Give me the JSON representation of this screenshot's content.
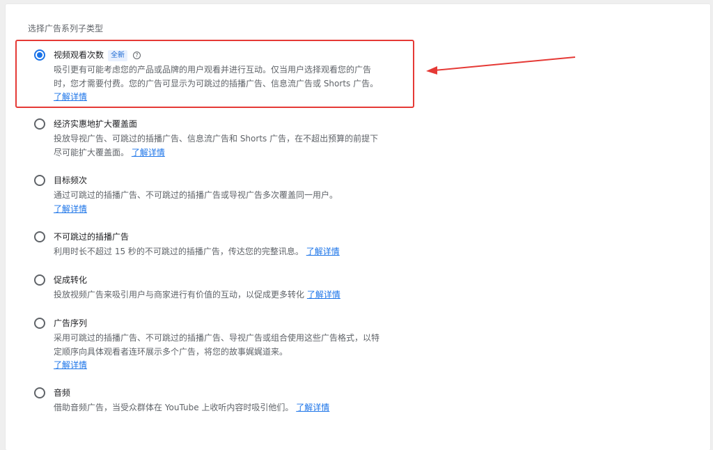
{
  "section": {
    "title": "选择广告系列子类型"
  },
  "options": [
    {
      "title": "视频观看次数",
      "badge": "全新",
      "help_icon": "help-circle-icon",
      "checked": true,
      "desc": "吸引更有可能考虑您的产品或品牌的用户观看并进行互动。仅当用户选择观看您的广告时，您才需要付费。您的广告可显示为可跳过的插播广告、信息流广告或 Shorts 广告。",
      "link": "了解详情"
    },
    {
      "title": "经济实惠地扩大覆盖面",
      "checked": false,
      "desc": "投放导视广告、可跳过的插播广告、信息流广告和 Shorts 广告，在不超出预算的前提下尽可能扩大覆盖面。",
      "link": "了解详情"
    },
    {
      "title": "目标频次",
      "checked": false,
      "desc": "通过可跳过的插播广告、不可跳过的插播广告或导视广告多次覆盖同一用户。",
      "link": "了解详情"
    },
    {
      "title": "不可跳过的插播广告",
      "checked": false,
      "desc": "利用时长不超过 15 秒的不可跳过的插播广告，传达您的完整讯息。",
      "link": "了解详情"
    },
    {
      "title": "促成转化",
      "checked": false,
      "desc": "投放视频广告来吸引用户与商家进行有价值的互动，以促成更多转化",
      "link": "了解详情"
    },
    {
      "title": "广告序列",
      "checked": false,
      "desc": "采用可跳过的插播广告、不可跳过的插播广告、导视广告或组合使用这些广告格式，以特定顺序向具体观看者连环展示多个广告，将您的故事娓娓道来。",
      "link": "了解详情"
    },
    {
      "title": "音频",
      "checked": false,
      "desc": "借助音频广告，当受众群体在 YouTube 上收听内容时吸引他们。",
      "link": "了解详情"
    }
  ],
  "colors": {
    "accent": "#1a73e8",
    "annotation": "#e53935"
  }
}
